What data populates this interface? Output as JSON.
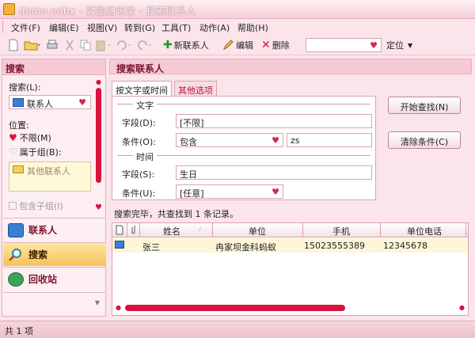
{
  "window": {
    "title": "demo.eabx - 效能通讯录 - 搜索联系人"
  },
  "menu": [
    "文件(F)",
    "编辑(E)",
    "视图(V)",
    "转到(G)",
    "工具(T)",
    "动作(A)",
    "帮助(H)"
  ],
  "toolbar": {
    "new_contact": "新联系人",
    "edit": "编辑",
    "delete": "删除",
    "locate": "定位"
  },
  "sidebar": {
    "header": "搜索",
    "search_label": "搜索(L):",
    "search_value": "联系人",
    "location_label": "位置:",
    "opt_unlimited": "不限(M)",
    "opt_group": "属于组(B):",
    "group_item": "其他联系人",
    "sub_group": "包含子组(I)",
    "nav": {
      "contacts": "联系人",
      "search": "搜索",
      "recycle": "回收站"
    }
  },
  "main": {
    "header": "搜索联系人",
    "tabs": {
      "text_time": "按文字或时间",
      "other": "其他选项"
    },
    "text_section": "文字",
    "field_label": "字段(D):",
    "field_value": "[不限]",
    "cond_label": "条件(O):",
    "cond_value": "包含",
    "cond_text": "zs",
    "time_section": "时间",
    "time_field_label": "字段(S):",
    "time_field_value": "生日",
    "time_cond_label": "条件(U):",
    "time_cond_value": "[任意]",
    "btn_start": "开始查找(N)",
    "btn_clear": "清除条件(C)",
    "status": "搜索完毕，共查找到 1 条记录。"
  },
  "grid": {
    "columns": [
      "姓名",
      "单位",
      "手机",
      "单位电话"
    ],
    "rows": [
      {
        "name": "张三",
        "company": "冉家坝金科蚂蚁",
        "mobile": "15023555389",
        "phone": "12345678"
      }
    ]
  },
  "statusbar": {
    "text": "共 1 项"
  },
  "colors": {
    "accent": "#d8123c",
    "background": "#fbe4ea",
    "header": "#7a1430"
  }
}
